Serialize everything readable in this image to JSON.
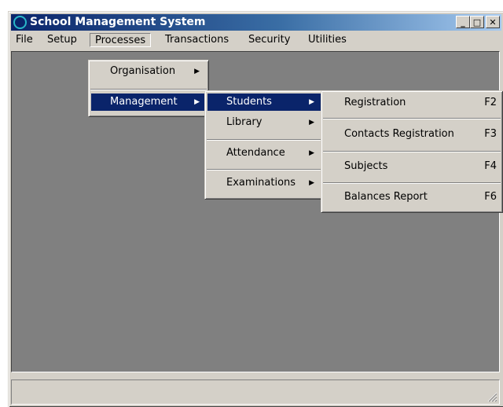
{
  "window": {
    "title": "School Management System",
    "min_label": "_",
    "max_label": "□",
    "close_label": "✕"
  },
  "menubar": {
    "items": [
      "File",
      "Setup",
      "Processes",
      "Transactions",
      "Security",
      "Utilities"
    ]
  },
  "processes_menu": {
    "items": [
      "Organisation",
      "Management"
    ]
  },
  "management_menu": {
    "items": [
      "Students",
      "Library",
      "Attendance",
      "Examinations"
    ]
  },
  "students_menu": {
    "items": [
      {
        "label": "Registration",
        "shortcut": "F2"
      },
      {
        "label": "Contacts Registration",
        "shortcut": "F3"
      },
      {
        "label": "Subjects",
        "shortcut": "F4"
      },
      {
        "label": "Balances Report",
        "shortcut": "F6"
      }
    ]
  },
  "icons": {
    "submenu_arrow": "▶",
    "app_icon": "ring-icon",
    "resize_grip": "resize-grip-icon"
  },
  "colors": {
    "title_bar": "#0a246a",
    "highlight": "#0a246a",
    "client_bg": "#808080",
    "face": "#d4d0c8"
  }
}
